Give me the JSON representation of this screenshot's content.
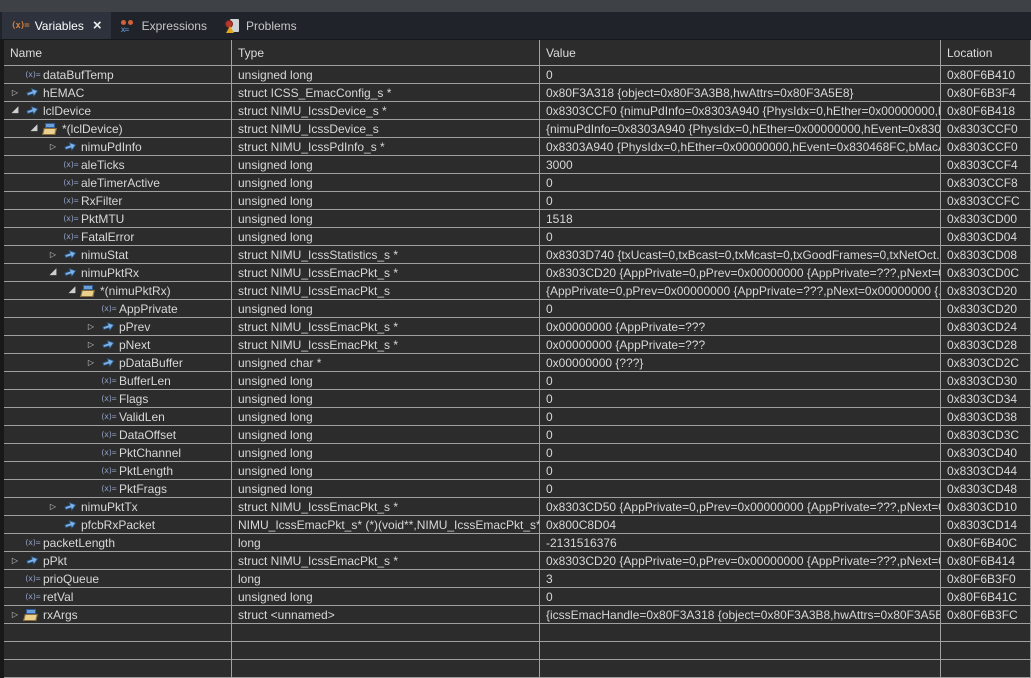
{
  "tabs": [
    {
      "label": "Variables",
      "active": true,
      "closable": true
    },
    {
      "label": "Expressions",
      "active": false,
      "closable": false
    },
    {
      "label": "Problems",
      "active": false,
      "closable": false
    }
  ],
  "glyphs": {
    "variable_icon": "(x)=",
    "tab_variables_icon": "(x)=",
    "expressions_icon_text": "x=",
    "collapsed_triangle": "▷",
    "expanded_triangle": "◢",
    "close_icon": "×"
  },
  "columns": [
    {
      "label": "Name"
    },
    {
      "label": "Type"
    },
    {
      "label": "Value"
    },
    {
      "label": "Location"
    }
  ],
  "colors": {
    "row_bg": "#2c2c2c",
    "grid_line": "#a0a0a0",
    "text": "#d8d8d8",
    "header_text": "#dcdcdc",
    "top_strip": "#3e4145",
    "tabbar_bg": "#20242a",
    "active_tab_bg": "#2d323d",
    "tab_icon_orange": "#cd7d3c",
    "pointer_blue": "#7db2e8",
    "var_icon_color": "#93a2c7",
    "struct_front": "#ecd18e",
    "struct_back": "#6d9fd8"
  },
  "empty_rows": 3,
  "variables": [
    {
      "name": "dataBufTemp",
      "icon": "variable",
      "expander": "none",
      "level": 0,
      "type": "unsigned long",
      "value": "0",
      "location": "0x80F6B410"
    },
    {
      "name": "hEMAC",
      "icon": "pointer",
      "expander": "collapsed",
      "level": 0,
      "type": "struct ICSS_EmacConfig_s *",
      "value": "0x80F3A318 {object=0x80F3A3B8,hwAttrs=0x80F3A5E8}",
      "location": "0x80F6B3F4"
    },
    {
      "name": "lclDevice",
      "icon": "pointer",
      "expander": "expanded",
      "level": 0,
      "type": "struct NIMU_IcssDevice_s *",
      "value": "0x8303CCF0 {nimuPdInfo=0x8303A940 {PhysIdx=0,hEther=0x00000000,h...",
      "location": "0x80F6B418"
    },
    {
      "name": "*(lclDevice)",
      "icon": "struct",
      "expander": "expanded",
      "level": 1,
      "type": "struct NIMU_IcssDevice_s",
      "value": "{nimuPdInfo=0x8303A940 {PhysIdx=0,hEther=0x00000000,hEvent=0x830...",
      "location": "0x8303CCF0"
    },
    {
      "name": "nimuPdInfo",
      "icon": "pointer",
      "expander": "collapsed",
      "level": 2,
      "type": "struct NIMU_IcssPdInfo_s *",
      "value": "0x8303A940 {PhysIdx=0,hEther=0x00000000,hEvent=0x830468FC,bMacA...",
      "location": "0x8303CCF0"
    },
    {
      "name": "aleTicks",
      "icon": "variable",
      "expander": "none",
      "level": 2,
      "type": "unsigned long",
      "value": "3000",
      "location": "0x8303CCF4"
    },
    {
      "name": "aleTimerActive",
      "icon": "variable",
      "expander": "none",
      "level": 2,
      "type": "unsigned long",
      "value": "0",
      "location": "0x8303CCF8"
    },
    {
      "name": "RxFilter",
      "icon": "variable",
      "expander": "none",
      "level": 2,
      "type": "unsigned long",
      "value": "0",
      "location": "0x8303CCFC"
    },
    {
      "name": "PktMTU",
      "icon": "variable",
      "expander": "none",
      "level": 2,
      "type": "unsigned long",
      "value": "1518",
      "location": "0x8303CD00"
    },
    {
      "name": "FatalError",
      "icon": "variable",
      "expander": "none",
      "level": 2,
      "type": "unsigned long",
      "value": "0",
      "location": "0x8303CD04"
    },
    {
      "name": "nimuStat",
      "icon": "pointer",
      "expander": "collapsed",
      "level": 2,
      "type": "struct NIMU_IcssStatistics_s *",
      "value": "0x8303D740 {txUcast=0,txBcast=0,txMcast=0,txGoodFrames=0,txNetOct...",
      "location": "0x8303CD08"
    },
    {
      "name": "nimuPktRx",
      "icon": "pointer",
      "expander": "expanded",
      "level": 2,
      "type": "struct NIMU_IcssEmacPkt_s *",
      "value": "0x8303CD20 {AppPrivate=0,pPrev=0x00000000 {AppPrivate=???,pNext=0...",
      "location": "0x8303CD0C"
    },
    {
      "name": "*(nimuPktRx)",
      "icon": "struct",
      "expander": "expanded",
      "level": 3,
      "type": "struct NIMU_IcssEmacPkt_s",
      "value": "{AppPrivate=0,pPrev=0x00000000 {AppPrivate=???,pNext=0x00000000 {...",
      "location": "0x8303CD20"
    },
    {
      "name": "AppPrivate",
      "icon": "variable",
      "expander": "none",
      "level": 4,
      "type": "unsigned long",
      "value": "0",
      "location": "0x8303CD20"
    },
    {
      "name": "pPrev",
      "icon": "pointer",
      "expander": "collapsed",
      "level": 4,
      "type": "struct NIMU_IcssEmacPkt_s *",
      "value": "0x00000000 {AppPrivate=???",
      "location": "0x8303CD24"
    },
    {
      "name": "pNext",
      "icon": "pointer",
      "expander": "collapsed",
      "level": 4,
      "type": "struct NIMU_IcssEmacPkt_s *",
      "value": "0x00000000 {AppPrivate=???",
      "location": "0x8303CD28"
    },
    {
      "name": "pDataBuffer",
      "icon": "pointer",
      "expander": "collapsed",
      "level": 4,
      "type": "unsigned char *",
      "value": "0x00000000 {???}",
      "location": "0x8303CD2C"
    },
    {
      "name": "BufferLen",
      "icon": "variable",
      "expander": "none",
      "level": 4,
      "type": "unsigned long",
      "value": "0",
      "location": "0x8303CD30"
    },
    {
      "name": "Flags",
      "icon": "variable",
      "expander": "none",
      "level": 4,
      "type": "unsigned long",
      "value": "0",
      "location": "0x8303CD34"
    },
    {
      "name": "ValidLen",
      "icon": "variable",
      "expander": "none",
      "level": 4,
      "type": "unsigned long",
      "value": "0",
      "location": "0x8303CD38"
    },
    {
      "name": "DataOffset",
      "icon": "variable",
      "expander": "none",
      "level": 4,
      "type": "unsigned long",
      "value": "0",
      "location": "0x8303CD3C"
    },
    {
      "name": "PktChannel",
      "icon": "variable",
      "expander": "none",
      "level": 4,
      "type": "unsigned long",
      "value": "0",
      "location": "0x8303CD40"
    },
    {
      "name": "PktLength",
      "icon": "variable",
      "expander": "none",
      "level": 4,
      "type": "unsigned long",
      "value": "0",
      "location": "0x8303CD44"
    },
    {
      "name": "PktFrags",
      "icon": "variable",
      "expander": "none",
      "level": 4,
      "type": "unsigned long",
      "value": "0",
      "location": "0x8303CD48"
    },
    {
      "name": "nimuPktTx",
      "icon": "pointer",
      "expander": "collapsed",
      "level": 2,
      "type": "struct NIMU_IcssEmacPkt_s *",
      "value": "0x8303CD50 {AppPrivate=0,pPrev=0x00000000 {AppPrivate=???,pNext=0...",
      "location": "0x8303CD10"
    },
    {
      "name": "pfcbRxPacket",
      "icon": "pointer",
      "expander": "none",
      "level": 2,
      "type": "NIMU_IcssEmacPkt_s* (*)(void**,NIMU_IcssEmacPkt_s*)",
      "value": "0x800C8D04",
      "location": "0x8303CD14"
    },
    {
      "name": "packetLength",
      "icon": "variable",
      "expander": "none",
      "level": 0,
      "type": "long",
      "value": "-2131516376",
      "location": "0x80F6B40C"
    },
    {
      "name": "pPkt",
      "icon": "pointer",
      "expander": "collapsed",
      "level": 0,
      "type": "struct NIMU_IcssEmacPkt_s *",
      "value": "0x8303CD20 {AppPrivate=0,pPrev=0x00000000 {AppPrivate=???,pNext=0...",
      "location": "0x80F6B414"
    },
    {
      "name": "prioQueue",
      "icon": "variable",
      "expander": "none",
      "level": 0,
      "type": "long",
      "value": "3",
      "location": "0x80F6B3F0"
    },
    {
      "name": "retVal",
      "icon": "variable",
      "expander": "none",
      "level": 0,
      "type": "unsigned long",
      "value": "0",
      "location": "0x80F6B41C"
    },
    {
      "name": "rxArgs",
      "icon": "struct",
      "expander": "collapsed",
      "level": 0,
      "type": "struct <unnamed>",
      "value": "{icssEmacHandle=0x80F3A318 {object=0x80F3A3B8,hwAttrs=0x80F3A5E...",
      "location": "0x80F6B3FC"
    }
  ]
}
